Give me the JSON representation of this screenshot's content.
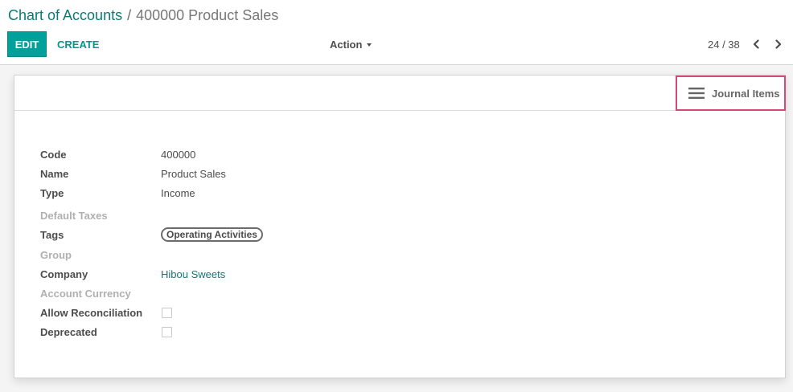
{
  "breadcrumb": {
    "parent": "Chart of Accounts",
    "separator": "/",
    "current": "400000 Product Sales"
  },
  "toolbar": {
    "edit_label": "EDIT",
    "create_label": "CREATE",
    "action_label": "Action"
  },
  "pager": {
    "value": "24 / 38"
  },
  "smart_button": {
    "label": "Journal Items",
    "icon": "list-icon"
  },
  "fields": {
    "code": {
      "label": "Code",
      "value": "400000"
    },
    "name": {
      "label": "Name",
      "value": "Product Sales"
    },
    "type": {
      "label": "Type",
      "value": "Income"
    },
    "default_taxes": {
      "label": "Default Taxes",
      "value": ""
    },
    "tags": {
      "label": "Tags",
      "value": "Operating Activities"
    },
    "group": {
      "label": "Group",
      "value": ""
    },
    "company": {
      "label": "Company",
      "value": "Hibou Sweets"
    },
    "account_currency": {
      "label": "Account Currency",
      "value": ""
    },
    "allow_reconciliation": {
      "label": "Allow Reconciliation",
      "checked": false
    },
    "deprecated": {
      "label": "Deprecated",
      "checked": false
    }
  },
  "colors": {
    "primary": "#01a09a",
    "link": "#0b7a75",
    "highlight": "#d6487a"
  }
}
